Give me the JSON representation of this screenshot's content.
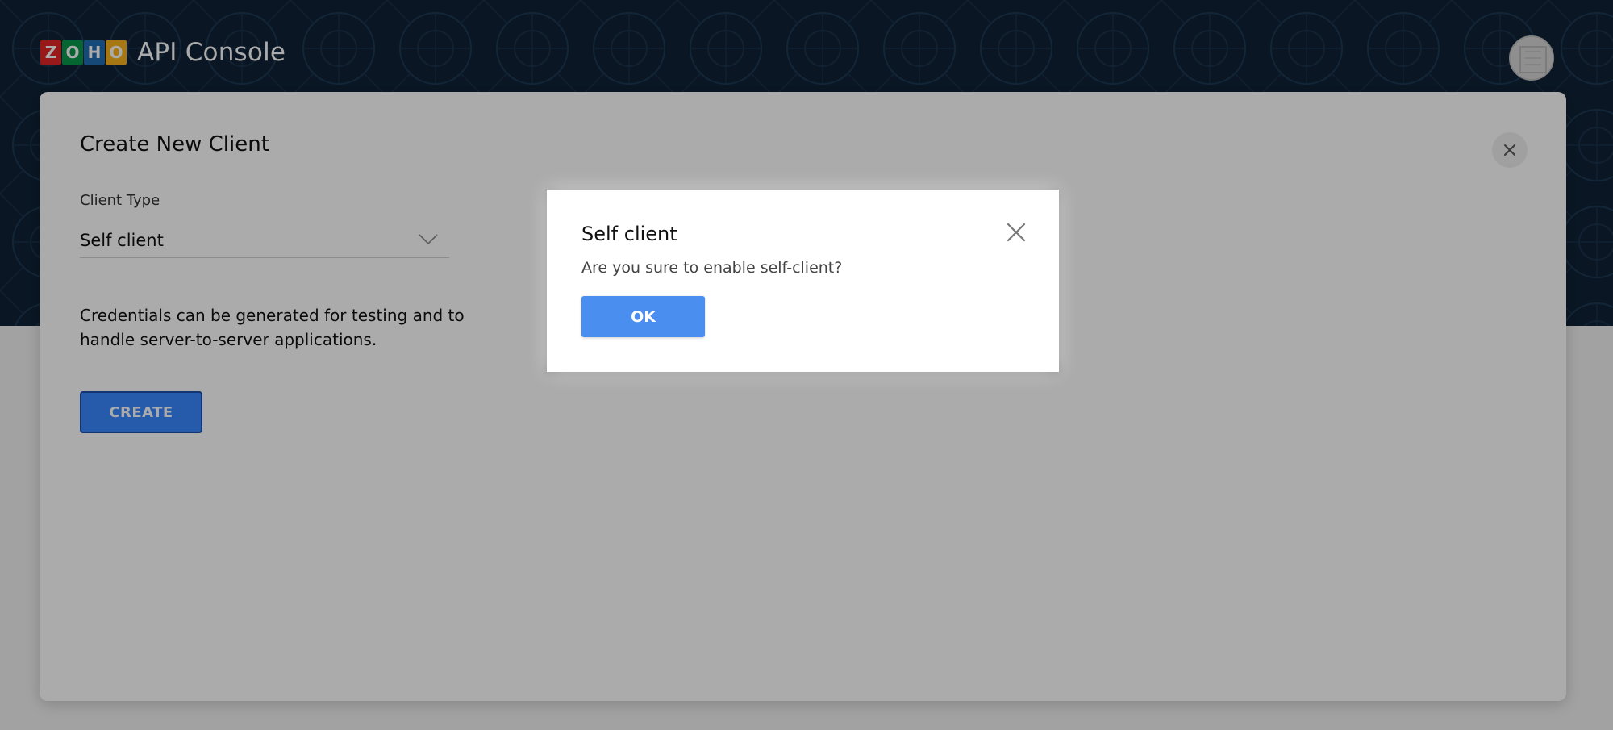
{
  "header": {
    "logo_letters": [
      {
        "char": "Z",
        "color": "#e42527"
      },
      {
        "char": "O",
        "color": "#089949"
      },
      {
        "char": "H",
        "color": "#226db4"
      },
      {
        "char": "O",
        "color": "#f9b21d"
      }
    ],
    "app_title": "API Console"
  },
  "panel": {
    "title": "Create New Client",
    "client_type_label": "Client Type",
    "client_type_value": "Self client",
    "description": "Credentials can be generated for testing and to handle server-to-server applications.",
    "create_label": "CREATE"
  },
  "dialog": {
    "title": "Self client",
    "message": "Are you sure to enable self-client?",
    "ok_label": "OK"
  },
  "icons": {
    "panel_close": "close-icon",
    "dialog_close": "close-icon",
    "select": "chevron-down-icon"
  },
  "colors": {
    "header_bg": "#0f2236",
    "primary_button": "#4a8ff0",
    "create_button_border": "#1c4fae",
    "page_bg": "#f2f2f2"
  }
}
